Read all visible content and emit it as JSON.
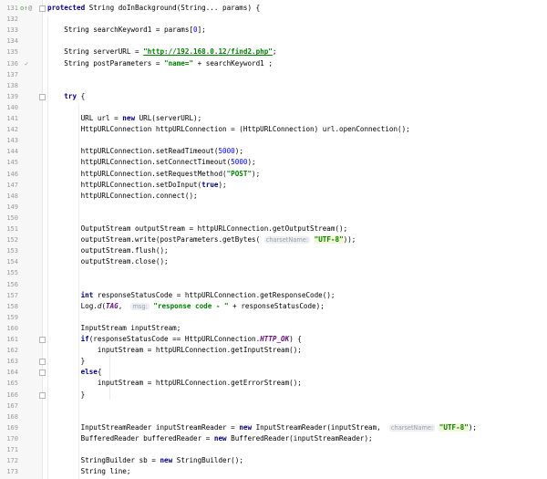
{
  "editor": {
    "gutter_markers": {
      "line131_override": "o↑",
      "line131_annotation": "@",
      "line136_check": "✓"
    },
    "lines": [
      {
        "n": "131",
        "t": [
          {
            "c": "kw",
            "v": "protected "
          },
          {
            "v": "String doInBackground(String... params) {"
          }
        ]
      },
      {
        "n": "132",
        "t": []
      },
      {
        "n": "133",
        "t": [
          {
            "v": "    String searchKeyword1 = params["
          },
          {
            "c": "num",
            "v": "0"
          },
          {
            "v": "];"
          }
        ]
      },
      {
        "n": "134",
        "t": []
      },
      {
        "n": "135",
        "t": [
          {
            "v": "    String serverURL = "
          },
          {
            "c": "url",
            "v": "\"http://192.168.0.12/find2.php\""
          },
          {
            "v": ";"
          }
        ]
      },
      {
        "n": "136",
        "t": [
          {
            "v": "    String postParameters = "
          },
          {
            "c": "str",
            "v": "\"name=\""
          },
          {
            "v": " + searchKeyword1 ;"
          }
        ]
      },
      {
        "n": "137",
        "t": []
      },
      {
        "n": "138",
        "t": []
      },
      {
        "n": "139",
        "t": [
          {
            "v": "    "
          },
          {
            "c": "kw",
            "v": "try"
          },
          {
            "v": " {"
          }
        ]
      },
      {
        "n": "140",
        "t": []
      },
      {
        "n": "141",
        "t": [
          {
            "v": "        URL url = "
          },
          {
            "c": "kw",
            "v": "new"
          },
          {
            "v": " URL(serverURL);"
          }
        ]
      },
      {
        "n": "142",
        "t": [
          {
            "v": "        HttpURLConnection httpURLConnection = (HttpURLConnection) url.openConnection();"
          }
        ]
      },
      {
        "n": "143",
        "t": []
      },
      {
        "n": "144",
        "t": [
          {
            "v": "        httpURLConnection.setReadTimeout("
          },
          {
            "c": "num",
            "v": "5000"
          },
          {
            "v": ");"
          }
        ]
      },
      {
        "n": "145",
        "t": [
          {
            "v": "        httpURLConnection.setConnectTimeout("
          },
          {
            "c": "num",
            "v": "5000"
          },
          {
            "v": ");"
          }
        ]
      },
      {
        "n": "146",
        "t": [
          {
            "v": "        httpURLConnection.setRequestMethod("
          },
          {
            "c": "str",
            "v": "\"POST\""
          },
          {
            "v": ");"
          }
        ]
      },
      {
        "n": "147",
        "t": [
          {
            "v": "        httpURLConnection.setDoInput("
          },
          {
            "c": "kw",
            "v": "true"
          },
          {
            "v": ");"
          }
        ]
      },
      {
        "n": "148",
        "t": [
          {
            "v": "        httpURLConnection.connect();"
          }
        ]
      },
      {
        "n": "149",
        "t": []
      },
      {
        "n": "150",
        "t": []
      },
      {
        "n": "151",
        "t": [
          {
            "v": "        OutputStream outputStream = httpURLConnection.getOutputStream();"
          }
        ]
      },
      {
        "n": "152",
        "t": [
          {
            "v": "        outputStream.write(postParameters.getBytes( "
          },
          {
            "c": "hint",
            "v": "charsetName:"
          },
          {
            "v": " "
          },
          {
            "c": "str hl",
            "v": "\"UTF-8\""
          },
          {
            "v": "));"
          }
        ]
      },
      {
        "n": "153",
        "t": [
          {
            "v": "        outputStream.flush();"
          }
        ]
      },
      {
        "n": "154",
        "t": [
          {
            "v": "        outputStream.close();"
          }
        ]
      },
      {
        "n": "155",
        "t": []
      },
      {
        "n": "156",
        "t": []
      },
      {
        "n": "157",
        "t": [
          {
            "v": "        "
          },
          {
            "c": "kw",
            "v": "int"
          },
          {
            "v": " responseStatusCode = httpURLConnection.getResponseCode();"
          }
        ]
      },
      {
        "n": "158",
        "t": [
          {
            "v": "        Log."
          },
          {
            "c": "ital",
            "v": "d"
          },
          {
            "v": "("
          },
          {
            "c": "fld",
            "v": "TAG"
          },
          {
            "v": ",  "
          },
          {
            "c": "hint",
            "v": "msg:"
          },
          {
            "v": " "
          },
          {
            "c": "str",
            "v": "\"response code - \""
          },
          {
            "v": " + responseStatusCode);"
          }
        ]
      },
      {
        "n": "159",
        "t": []
      },
      {
        "n": "160",
        "t": [
          {
            "v": "        InputStream inputStream;"
          }
        ]
      },
      {
        "n": "161",
        "t": [
          {
            "v": "        "
          },
          {
            "c": "kw",
            "v": "if"
          },
          {
            "v": "(responseStatusCode == HttpURLConnection."
          },
          {
            "c": "fld",
            "v": "HTTP_OK"
          },
          {
            "v": ") {"
          }
        ]
      },
      {
        "n": "162",
        "t": [
          {
            "v": "            inputStream = httpURLConnection.getInputStream();"
          }
        ]
      },
      {
        "n": "163",
        "t": [
          {
            "v": "        }"
          }
        ]
      },
      {
        "n": "164",
        "t": [
          {
            "v": "        "
          },
          {
            "c": "kw",
            "v": "else"
          },
          {
            "v": "{"
          }
        ]
      },
      {
        "n": "165",
        "t": [
          {
            "v": "            inputStream = httpURLConnection.getErrorStream();"
          }
        ]
      },
      {
        "n": "166",
        "t": [
          {
            "v": "        }"
          }
        ]
      },
      {
        "n": "167",
        "t": []
      },
      {
        "n": "168",
        "t": []
      },
      {
        "n": "169",
        "t": [
          {
            "v": "        InputStreamReader inputStreamReader = "
          },
          {
            "c": "kw",
            "v": "new"
          },
          {
            "v": " InputStreamReader(inputStream,  "
          },
          {
            "c": "hint",
            "v": "charsetName:"
          },
          {
            "v": " "
          },
          {
            "c": "str hl",
            "v": "\"UTF-8\""
          },
          {
            "v": ");"
          }
        ]
      },
      {
        "n": "170",
        "t": [
          {
            "v": "        BufferedReader bufferedReader = "
          },
          {
            "c": "kw",
            "v": "new"
          },
          {
            "v": " BufferedReader(inputStreamReader);"
          }
        ]
      },
      {
        "n": "171",
        "t": []
      },
      {
        "n": "172",
        "t": [
          {
            "v": "        StringBuilder sb = "
          },
          {
            "c": "kw",
            "v": "new"
          },
          {
            "v": " StringBuilder();"
          }
        ]
      },
      {
        "n": "173",
        "t": [
          {
            "v": "        String line;"
          }
        ]
      }
    ]
  },
  "colors": {
    "keyword": "#000080",
    "string": "#008000",
    "number": "#0000ff",
    "field": "#660e7a",
    "gutter_bg": "#f7f7f7",
    "line_number": "#999999"
  }
}
